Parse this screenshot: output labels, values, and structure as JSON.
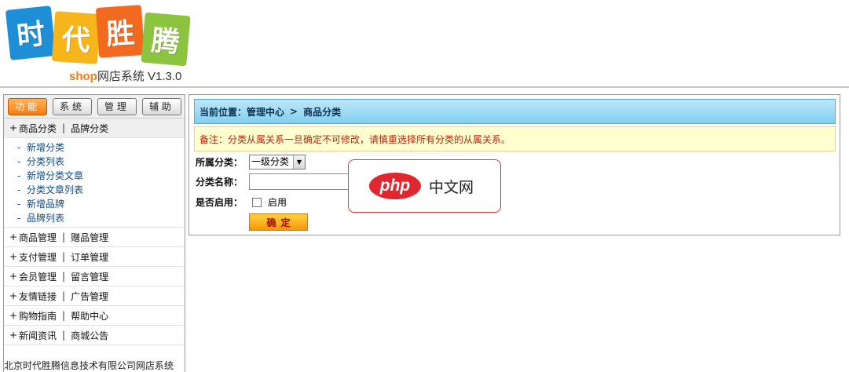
{
  "header": {
    "logo_chars": [
      "时",
      "代",
      "胜",
      "腾"
    ],
    "logo_colors": [
      "#1e8fd6",
      "#f7b51c",
      "#f16a1f",
      "#8cc43f"
    ],
    "sub_shop": "shop",
    "sub_text": "网店系统 V1.3.0"
  },
  "sidebar": {
    "top_buttons": [
      {
        "label": "功能",
        "active": true
      },
      {
        "label": "系统",
        "active": false
      },
      {
        "label": "管理",
        "active": false
      },
      {
        "label": "辅助",
        "active": false
      }
    ],
    "groups": [
      {
        "plus": "+",
        "left": "商品分类",
        "sep": "|",
        "right": "品牌分类",
        "open": true,
        "items": [
          "新增分类",
          "分类列表",
          "新增分类文章",
          "分类文章列表",
          "新增品牌",
          "品牌列表"
        ]
      },
      {
        "plus": "+",
        "left": "商品管理",
        "sep": "|",
        "right": "赠品管理"
      },
      {
        "plus": "+",
        "left": "支付管理",
        "sep": "|",
        "right": "订单管理"
      },
      {
        "plus": "+",
        "left": "会员管理",
        "sep": "|",
        "right": "留言管理"
      },
      {
        "plus": "+",
        "left": "友情链接",
        "sep": "|",
        "right": "广告管理"
      },
      {
        "plus": "+",
        "left": "购物指南",
        "sep": "|",
        "right": "帮助中心"
      },
      {
        "plus": "+",
        "left": "新闻资讯",
        "sep": "|",
        "right": "商城公告"
      }
    ],
    "item_dash": "-",
    "footer": "北京时代胜腾信息技术有限公司网店系统"
  },
  "main": {
    "breadcrumb": {
      "label": "当前位置：",
      "level1": "管理中心",
      "arrow": ">",
      "level2": "商品分类"
    },
    "notice": "备注：分类从属关系一旦确定不可修改，请慎重选择所有分类的从属关系。",
    "form": {
      "parent_label": "所属分类：",
      "parent_value": "一级分类",
      "name_label": "分类名称：",
      "name_value": "",
      "enable_label": "是否启用：",
      "enable_option": "启用",
      "enable_checked": false,
      "submit_label": "确定"
    }
  },
  "watermark": {
    "php": "php",
    "text": "中文网"
  }
}
